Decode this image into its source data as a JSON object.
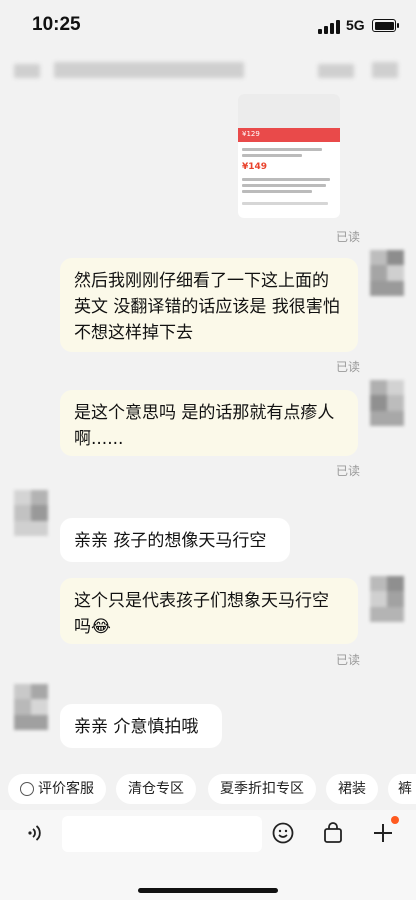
{
  "status_bar": {
    "time": "10:25",
    "network": "5G"
  },
  "card": {
    "price_top": "¥129",
    "price_main": "¥149"
  },
  "messages": [
    {
      "text": "然后我刚刚仔细看了一下这上面的英文 没翻译错的话应该是 我很害怕 不想这样掉下去",
      "read": "已读"
    },
    {
      "text": "是这个意思吗 是的话那就有点瘆人啊......",
      "read": "已读"
    },
    {
      "text": "亲亲 孩子的想像天马行空"
    },
    {
      "text": "这个只是代表孩子们想象天马行空吗😂",
      "read": "已读"
    },
    {
      "text": "亲亲 介意慎拍哦"
    }
  ],
  "first_read": "已读",
  "quick_bar": [
    "评价客服",
    "清仓专区",
    "夏季折扣专区",
    "裙装",
    "裤"
  ],
  "icons": {
    "voice": "voice-icon",
    "emoji": "emoji-icon",
    "bag": "shopping-bag-icon",
    "plus": "plus-icon"
  }
}
